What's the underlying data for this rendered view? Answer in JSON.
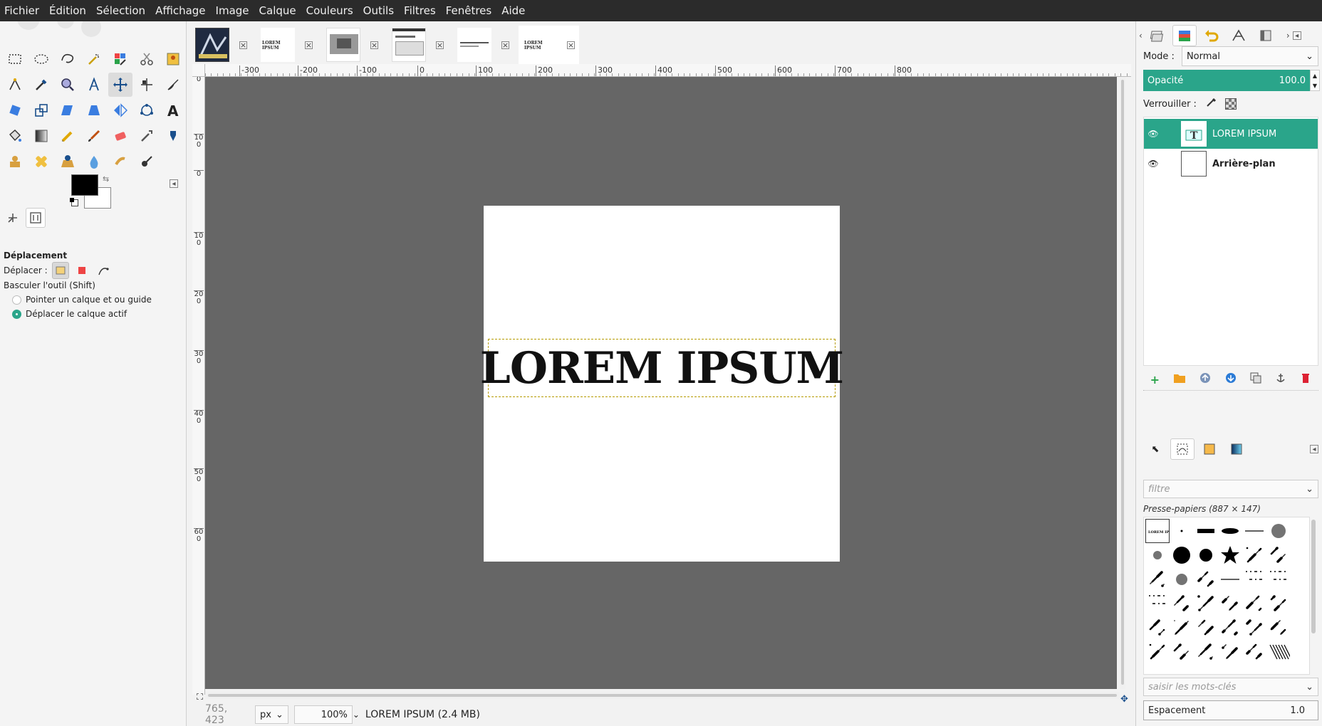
{
  "menubar": {
    "items": [
      "Fichier",
      "Édition",
      "Sélection",
      "Affichage",
      "Image",
      "Calque",
      "Couleurs",
      "Outils",
      "Filtres",
      "Fenêtres",
      "Aide"
    ]
  },
  "toolbox": {
    "tools": [
      "rect-select-icon",
      "ellipse-select-icon",
      "free-select-icon",
      "fuzzy-select-icon",
      "select-by-color-icon",
      "scissors-icon",
      "foreground-select-icon",
      "paths-icon",
      "color-picker-icon",
      "zoom-icon",
      "measure-icon",
      "move-icon",
      "align-icon",
      "transform-icon",
      "rotate-icon",
      "scale-icon",
      "shear-icon",
      "perspective-icon",
      "flip-icon",
      "cage-icon",
      "text-icon",
      "bucket-fill-icon",
      "gradient-icon",
      "pencil-icon",
      "paintbrush-icon",
      "eraser-icon",
      "airbrush-icon",
      "ink-icon",
      "clone-icon",
      "heal-icon",
      "perspective-clone-icon",
      "blur-icon",
      "smudge-icon",
      "dodge-burn-icon"
    ],
    "active_tool_index": 11,
    "foreground_color": "#000000",
    "background_color": "#ffffff"
  },
  "tool_options": {
    "title": "Déplacement",
    "move_label": "Déplacer :",
    "toggle_label": "Basculer l'outil  (Shift)",
    "options": [
      {
        "label": "Pointer un calque et ou guide",
        "selected": false
      },
      {
        "label": "Déplacer le calque actif",
        "selected": true
      }
    ]
  },
  "image_tabs": [
    {
      "name": "tab-image-1",
      "active": false
    },
    {
      "name": "tab-image-2",
      "active": false
    },
    {
      "name": "tab-image-3",
      "active": false
    },
    {
      "name": "tab-image-4",
      "active": false
    },
    {
      "name": "tab-image-5",
      "active": false
    },
    {
      "name": "tab-image-6",
      "active": true
    }
  ],
  "thumb_caption": "LOREM IPSUM",
  "ruler": {
    "h_labels": [
      "400",
      "-300",
      "-200",
      "-100",
      "0",
      "100",
      "200",
      "300",
      "400",
      "500",
      "600",
      "700",
      "800"
    ],
    "v_labels": [
      "0",
      "100",
      "0",
      "100",
      "200",
      "300",
      "400",
      "500",
      "600"
    ]
  },
  "canvas": {
    "text": "LOREM IPSUM",
    "canvas_bg": "#666666",
    "page_bg": "#ffffff"
  },
  "status": {
    "coords": "765, 423",
    "unit": "px",
    "zoom": "100%",
    "info": "LOREM IPSUM (2.4 MB)"
  },
  "layers": {
    "mode_label": "Mode :",
    "mode_value": "Normal",
    "opacity_label": "Opacité",
    "opacity_value": "100.0",
    "lock_label": "Verrouiller :",
    "items": [
      {
        "name": "LOREM IPSUM",
        "selected": true
      },
      {
        "name": "Arrière-plan",
        "selected": false
      }
    ],
    "accent": "#2aa58a"
  },
  "brushes": {
    "filter_placeholder": "filtre",
    "title": "Presse-papiers (887 × 147)",
    "tags_placeholder": "saisir les mots-clés",
    "spacing_label": "Espacement",
    "spacing_value": "1.0"
  }
}
